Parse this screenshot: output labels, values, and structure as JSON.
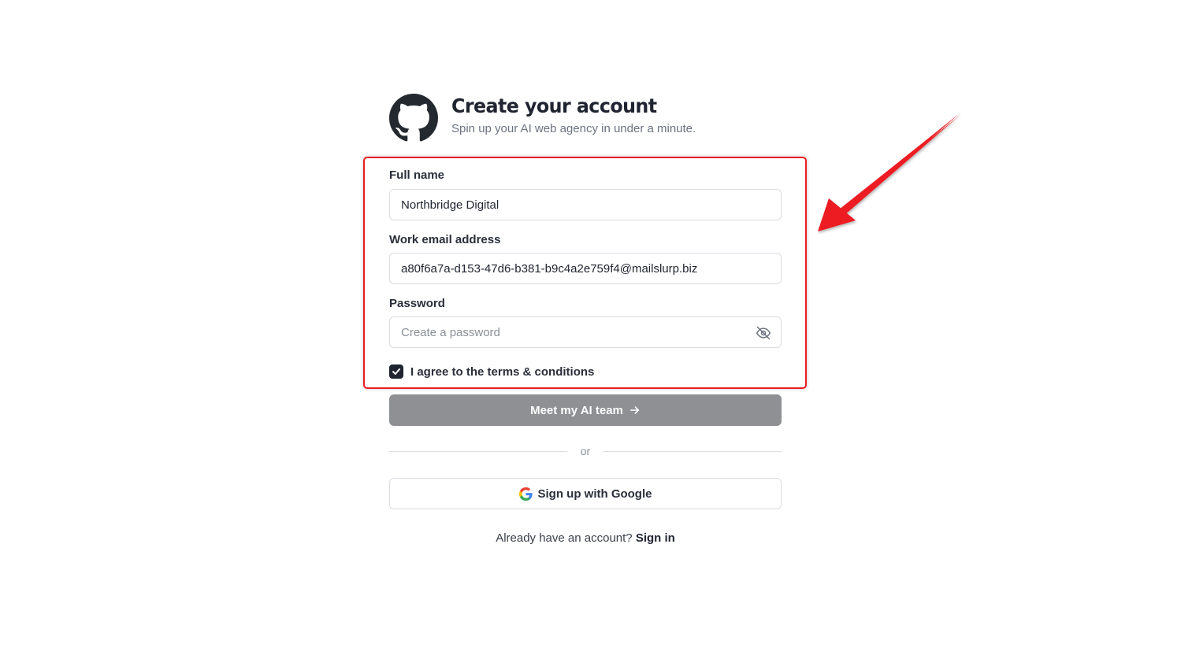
{
  "header": {
    "title": "Create your account",
    "subtitle": "Spin up your AI web agency in under a minute.",
    "logo_icon": "github-icon"
  },
  "form": {
    "full_name": {
      "label": "Full name",
      "value": "Northbridge Digital"
    },
    "email": {
      "label": "Work email address",
      "value": "a80f6a7a-d153-47d6-b381-b9c4a2e759f4@mailslurp.biz"
    },
    "password": {
      "label": "Password",
      "placeholder": "Create a password",
      "toggle_icon": "eye-off-icon"
    },
    "terms": {
      "label": "I agree to the terms & conditions",
      "checked": true
    },
    "submit_label": "Meet my AI team"
  },
  "divider": {
    "text": "or"
  },
  "google": {
    "label": "Sign up with Google"
  },
  "signin": {
    "prompt": "Already have an account?",
    "link": "Sign in"
  },
  "colors": {
    "annotation": "#ec1c24",
    "primary_disabled": "#8e9094",
    "text_dark": "#1f2430"
  }
}
